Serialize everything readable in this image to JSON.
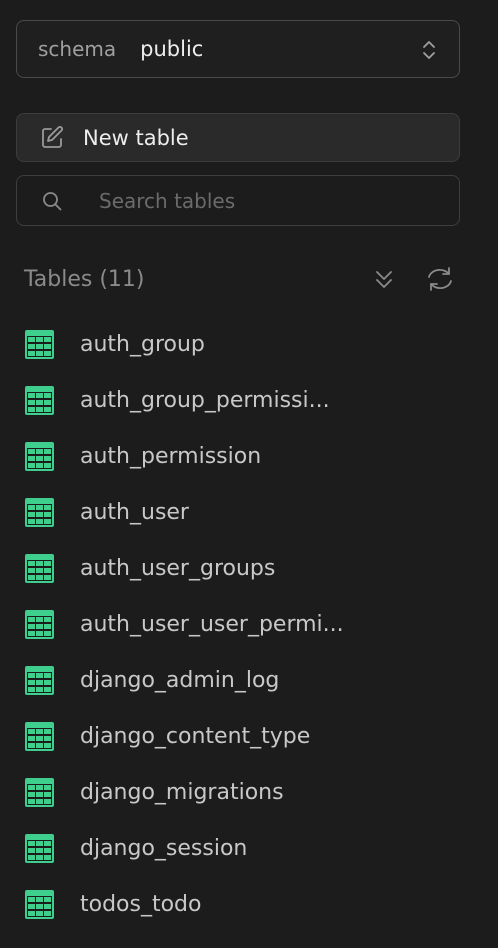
{
  "schema": {
    "label": "schema",
    "value": "public"
  },
  "toolbar": {
    "new_table_label": "New table"
  },
  "search": {
    "placeholder": "Search tables",
    "value": ""
  },
  "tables": {
    "title": "Tables (11)",
    "items": [
      {
        "name": "auth_group"
      },
      {
        "name": "auth_group_permissi..."
      },
      {
        "name": "auth_permission"
      },
      {
        "name": "auth_user"
      },
      {
        "name": "auth_user_groups"
      },
      {
        "name": "auth_user_user_permi..."
      },
      {
        "name": "django_admin_log"
      },
      {
        "name": "django_content_type"
      },
      {
        "name": "django_migrations"
      },
      {
        "name": "django_session"
      },
      {
        "name": "todos_todo"
      }
    ]
  },
  "icons": {
    "schema_toggle": "chevrons-up-down-icon",
    "new_table": "edit-icon",
    "search": "search-icon",
    "collapse": "chevrons-down-icon",
    "refresh": "refresh-icon",
    "table": "table-grid-icon"
  },
  "colors": {
    "background": "#1c1c1c",
    "table_icon": "#3ecf8e",
    "text": "#c8c8c8",
    "muted": "#8a8a8a"
  }
}
